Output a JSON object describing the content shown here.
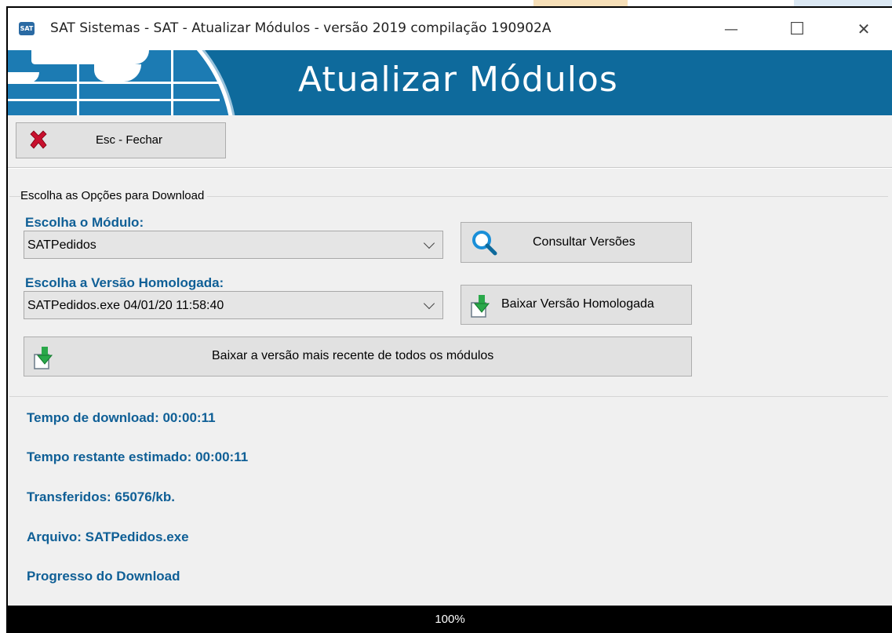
{
  "window": {
    "title": "SAT Sistemas - SAT - Atualizar Módulos - versão 2019 compilação 190902A",
    "app_icon_text": "SAT",
    "controls": {
      "minimize": "—",
      "maximize": "☐",
      "close": "✕"
    }
  },
  "banner": {
    "title": "Atualizar Módulos"
  },
  "toolbar": {
    "close_label": "Esc - Fechar"
  },
  "group": {
    "title": "Escolha as Opções para Download",
    "module_label": "Escolha o Módulo:",
    "module_value": "SATPedidos",
    "version_label": "Escolha a Versão Homologada:",
    "version_value": "SATPedidos.exe 04/01/20 11:58:40",
    "consult_button": "Consultar Versões",
    "download_button": "Baixar Versão Homologada",
    "download_all_button": "Baixar a versão mais recente de todos os módulos"
  },
  "status": {
    "download_time": "Tempo de download: 00:00:11",
    "remaining_time": "Tempo restante estimado: 00:00:11",
    "transferred": "Transferidos: 65076/kb.",
    "file": "Arquivo: SATPedidos.exe",
    "progress_label": "Progresso do Download"
  },
  "progress": {
    "value": 100,
    "text": "100%"
  },
  "colors": {
    "banner": "#0e6a9c",
    "label_blue": "#0f5f96",
    "progress_bar": "#000000"
  },
  "icons": [
    "close-x-icon",
    "magnifier-icon",
    "download-arrow-icon",
    "chevron-down-icon"
  ]
}
